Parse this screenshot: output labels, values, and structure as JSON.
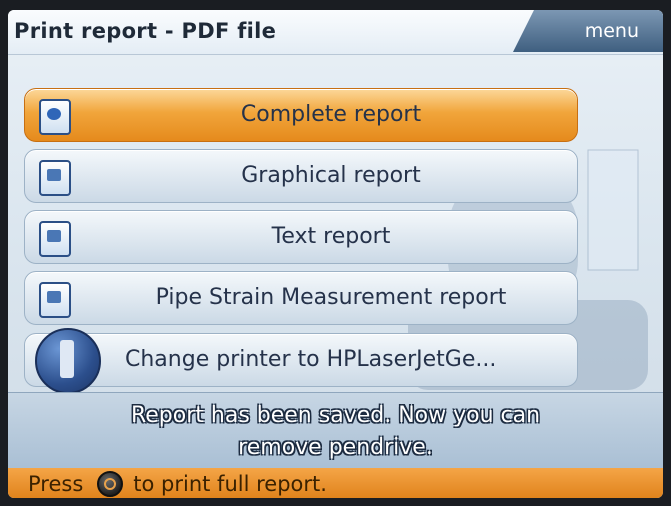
{
  "header": {
    "title": "Print report - PDF file",
    "menu_label": "menu"
  },
  "report_options": [
    {
      "label": "Complete report",
      "icon": "document-globe-icon",
      "selected": true
    },
    {
      "label": "Graphical report",
      "icon": "document-chart-icon",
      "selected": false
    },
    {
      "label": "Text report",
      "icon": "document-text-icon",
      "selected": false
    },
    {
      "label": "Pipe Strain Measurement report",
      "icon": "document-list-icon",
      "selected": false
    }
  ],
  "printer_option": {
    "label": "Change printer to HPLaserJetGe...",
    "icon": "printer-icon"
  },
  "notice": {
    "line1": "Report has been saved. Now you can",
    "line2": "remove pendrive."
  },
  "status": {
    "prefix": "Press",
    "key_icon": "print-key-icon",
    "suffix": "to print full report."
  },
  "colors": {
    "accent": "#e58a1c",
    "menu": "#3f5f80",
    "row": "#cbd9e6"
  }
}
